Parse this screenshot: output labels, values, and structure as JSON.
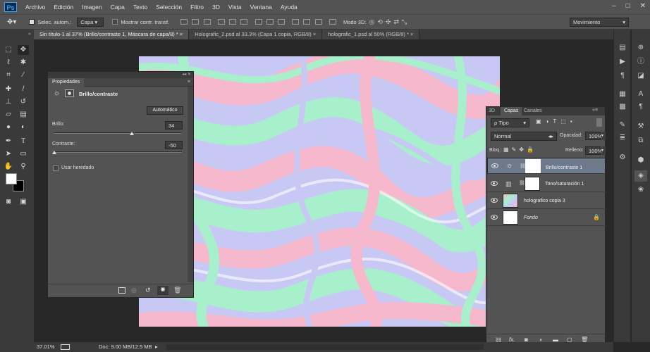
{
  "app": {
    "logo": "Ps"
  },
  "menu": [
    "Archivo",
    "Edición",
    "Imagen",
    "Capa",
    "Texto",
    "Selección",
    "Filtro",
    "3D",
    "Vista",
    "Ventana",
    "Ayuda"
  ],
  "window_buttons": [
    "–",
    "□",
    "✕"
  ],
  "options": {
    "auto_select_label": "Selec. autom.:",
    "auto_select_value": "Capa",
    "show_transform_label": "Mostrar contr. transf.",
    "mode3d_label": "Modo 3D:",
    "workspace_value": "Movimiento"
  },
  "tabs": [
    "Sin título-1 al 37% (Brillo/contraste 1, Máscara de capa/8) *",
    "Holografic_2.psd al 33.3% (Capa 1 copia, RGB/8)",
    "holografic_1.psd al 50% (RGB/8) *"
  ],
  "tab_close": "×",
  "properties": {
    "panel_title": "Propiedades",
    "adjustment_name": "Brillo/contraste",
    "auto_button": "Automático",
    "brightness_label": "Brillo:",
    "brightness_value": "34",
    "brightness_level": 34,
    "contrast_label": "Contraste:",
    "contrast_value": "-50",
    "contrast_level": -50,
    "legacy_label": "Usar heredado"
  },
  "layers_panel": {
    "tabs": [
      "3D",
      "Capas",
      "Canales"
    ],
    "active_tab": "Capas",
    "filter_value": "ρ Tipo",
    "blend_mode": "Normal",
    "opacity_label": "Opacidad:",
    "opacity_value": "100%",
    "lock_label": "Bloq.:",
    "fill_label": "Relleno:",
    "fill_value": "100%",
    "layers": [
      {
        "name": "Brillo/contraste 1",
        "selected": true
      },
      {
        "name": "Tono/saturación 1",
        "selected": false
      },
      {
        "name": "holografico copia 3",
        "selected": false
      },
      {
        "name": "Fondo",
        "selected": false
      }
    ]
  },
  "status": {
    "zoom": "37.01%",
    "doc_info": "Doc: 9.00 MB/12.5 MB"
  },
  "colors": {
    "ui_dark": "#282828",
    "ui_panel": "#535353",
    "canvas_pink": "#f6b8cd",
    "canvas_mint": "#a8f0cc",
    "canvas_lavender": "#c8c8f5",
    "selected_layer": "#6e7a8c"
  }
}
